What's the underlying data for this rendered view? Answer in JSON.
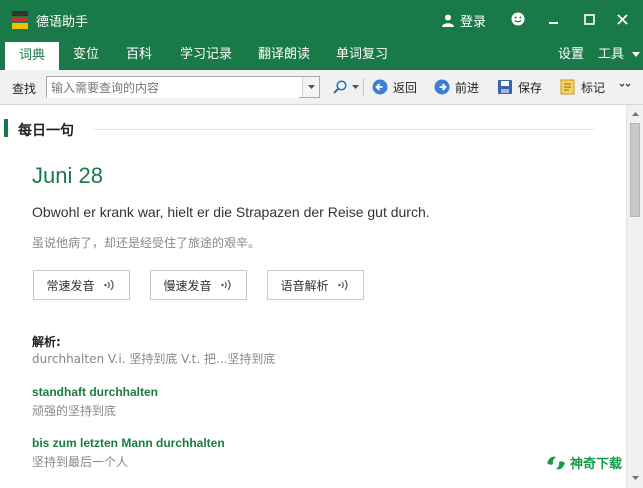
{
  "app": {
    "title": "德语助手",
    "login": "登录"
  },
  "tabs": [
    {
      "label": "词典",
      "active": true
    },
    {
      "label": "变位"
    },
    {
      "label": "百科"
    },
    {
      "label": "学习记录"
    },
    {
      "label": "翻译朗读"
    },
    {
      "label": "单词复习"
    }
  ],
  "right_menu": {
    "settings": "设置",
    "tools": "工具"
  },
  "toolbar": {
    "search_label": "查找",
    "search_placeholder": "输入需要查询的内容",
    "back": "返回",
    "forward": "前进",
    "save": "保存",
    "mark": "标记"
  },
  "daily": {
    "section_title": "每日一句",
    "date": "Juni 28",
    "german": "Obwohl er krank war, hielt er die Strapazen der Reise gut durch.",
    "chinese": "虽说他病了，却还是经受住了旅途的艰辛。",
    "buttons": {
      "normal": "常速发音",
      "slow": "慢速发音",
      "analysis": "语音解析"
    }
  },
  "analysis": {
    "label": "解析:",
    "definition": "durchhalten V.i. 坚持到底 V.t. 把...坚持到底",
    "entries": [
      {
        "phrase": "standhaft durchhalten",
        "meaning": "顽强的坚持到底"
      },
      {
        "phrase": "bis zum letzten Mann durchhalten",
        "meaning": "坚持到最后一个人"
      }
    ]
  },
  "watermark": {
    "text": "神奇下载"
  },
  "colors": {
    "brand_green": "#1a7a47",
    "toolbar_bg": "#f1f1f1"
  }
}
